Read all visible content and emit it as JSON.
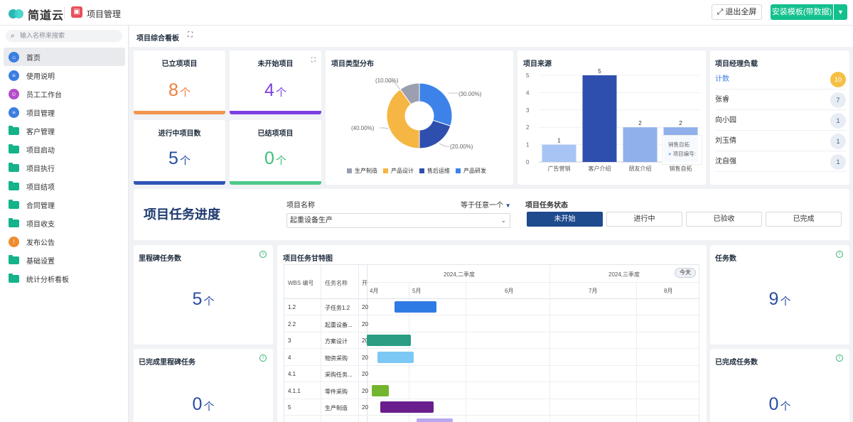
{
  "topbar": {
    "brand": "简道云",
    "app_name": "项目管理",
    "exit_fullscreen": "⤢ 退出全屏",
    "install": "安装模板(带数据)"
  },
  "sidebar": {
    "search_placeholder": "输入名称来搜索",
    "items": [
      {
        "label": "首页",
        "icon": "home-icon",
        "color": "#3b7de0",
        "active": true
      },
      {
        "label": "使用说明",
        "icon": "doc-icon",
        "color": "#3b7de0"
      },
      {
        "label": "员工工作台",
        "icon": "user-icon",
        "color": "#b44cc9"
      },
      {
        "label": "项目管理",
        "icon": "doc-icon",
        "color": "#3b7de0"
      },
      {
        "label": "客户管理",
        "icon": "folder-icon",
        "color": "#14b38a"
      },
      {
        "label": "项目启动",
        "icon": "folder-icon",
        "color": "#14b38a"
      },
      {
        "label": "项目执行",
        "icon": "folder-icon",
        "color": "#14b38a"
      },
      {
        "label": "项目结项",
        "icon": "folder-icon",
        "color": "#14b38a"
      },
      {
        "label": "合同管理",
        "icon": "folder-icon",
        "color": "#14b38a"
      },
      {
        "label": "项目收支",
        "icon": "folder-icon",
        "color": "#14b38a"
      },
      {
        "label": "发布公告",
        "icon": "announce-icon",
        "color": "#f08c2e"
      },
      {
        "label": "基础设置",
        "icon": "folder-icon",
        "color": "#14b38a"
      },
      {
        "label": "统计分析看板",
        "icon": "folder-icon",
        "color": "#14b38a"
      }
    ]
  },
  "board": {
    "title": "项目综合看板"
  },
  "stats": {
    "established": {
      "title": "已立项项目",
      "value": "8",
      "unit": "个",
      "color": "#f07c3a"
    },
    "not_started": {
      "title": "未开始项目",
      "value": "4",
      "unit": "个",
      "color": "#7b3fe4"
    },
    "in_progress": {
      "title": "进行中项目数",
      "value": "5",
      "unit": "个",
      "color": "#2b4ea2"
    },
    "closed": {
      "title": "已结项项目",
      "value": "0",
      "unit": "个",
      "color": "#3bbf7a"
    }
  },
  "pie": {
    "title": "项目类型分布",
    "labels": {
      "a": "(10.00%)",
      "b": "(30.00%)",
      "c": "(20.00%)",
      "d": "(40.00%)"
    }
  },
  "bar": {
    "title": "项目来源",
    "tooltip_title": "销售自拓",
    "tooltip_line": "项目编号:"
  },
  "chart_data": [
    {
      "type": "pie",
      "title": "项目类型分布",
      "categories": [
        "生产制造",
        "产品设计",
        "售后运维",
        "产品研发"
      ],
      "values": [
        10.0,
        40.0,
        20.0,
        30.0
      ],
      "colors": [
        "#9b9fb0",
        "#f6b643",
        "#2f4fae",
        "#3c82e8"
      ],
      "legend": "bottom"
    },
    {
      "type": "bar",
      "title": "项目来源",
      "categories": [
        "广告营销",
        "客户介绍",
        "朋友介绍",
        "销售自拓"
      ],
      "values": [
        1,
        5,
        2,
        2
      ],
      "colors": [
        "#a8c4f5",
        "#2f4fae",
        "#8fb0ea",
        "#8fb0ea"
      ],
      "ylim": [
        0,
        5
      ],
      "yticks": [
        0,
        1,
        2,
        3,
        4,
        5
      ]
    }
  ],
  "managers": {
    "title": "项目经理负载",
    "rows": [
      {
        "name": "计数",
        "count": "10",
        "highlight": true
      },
      {
        "name": "张睿",
        "count": "7"
      },
      {
        "name": "向小园",
        "count": "1"
      },
      {
        "name": "刘玉倩",
        "count": "1"
      },
      {
        "name": "沈自强",
        "count": "1"
      }
    ]
  },
  "progress": {
    "title": "项目任务进度",
    "project_label": "项目名称",
    "match_mode": "等于任意一个",
    "project_value": "起重设备生产",
    "status_label": "项目任务状态",
    "statuses": [
      "未开始",
      "进行中",
      "已验收",
      "已完成"
    ]
  },
  "milestone": {
    "title": "里程碑任务数",
    "value": "5",
    "unit": "个"
  },
  "milestone_done": {
    "title": "已完成里程碑任务",
    "value": "0",
    "unit": "个"
  },
  "tasks": {
    "title": "任务数",
    "value": "9",
    "unit": "个"
  },
  "tasks_done": {
    "title": "已完成任务数",
    "value": "0",
    "unit": "个"
  },
  "gantt": {
    "title": "项目任务甘特图",
    "col_wbs": "WBS 编号",
    "col_name": "任务名称",
    "col_start": "开",
    "quarter2": "2024,二季度",
    "quarter3": "2024,三季度",
    "today": "今天",
    "months": [
      "4月",
      "5月",
      "6月",
      "7月",
      "8月"
    ],
    "rows": [
      {
        "wbs": "1.2",
        "name": "子任务1.2",
        "start": "20",
        "color": "#2f7be6"
      },
      {
        "wbs": "2.2",
        "name": "起重设备...",
        "start": "20",
        "color": ""
      },
      {
        "wbs": "3",
        "name": "方案设计",
        "start": "20",
        "color": "#2a9d82"
      },
      {
        "wbs": "4",
        "name": "物资采购",
        "start": "20",
        "color": "#7cc8f4"
      },
      {
        "wbs": "4.1",
        "name": "采购任务...",
        "start": "20",
        "color": ""
      },
      {
        "wbs": "4.1.1",
        "name": "零件采购",
        "start": "20",
        "color": "#72b52e"
      },
      {
        "wbs": "5",
        "name": "生产制造",
        "start": "20",
        "color": "#6a1e8e"
      },
      {
        "wbs": "",
        "name": "",
        "start": "",
        "color": "#b7a8f0"
      }
    ]
  }
}
